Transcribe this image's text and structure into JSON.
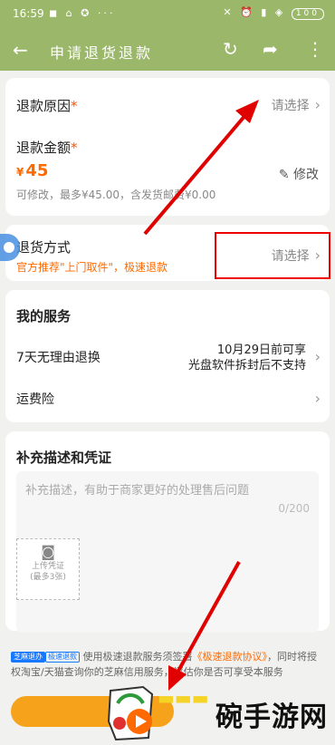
{
  "status_bar": {
    "time": "16:59",
    "left_icons": "◼ ⌂ ✪ ···",
    "right_icons": "✕ ⏰ ▮ ◈",
    "battery": "100"
  },
  "header": {
    "title": "申请退货退款"
  },
  "reason": {
    "label": "退款原因",
    "required_mark": "*",
    "action": "请选择",
    "chevron": "›"
  },
  "amount": {
    "label": "退款金额",
    "required_mark": "*",
    "currency": "¥",
    "value": "45",
    "hint": "可修改，最多¥45.00，含发货邮费¥0.00",
    "edit_label": "修改"
  },
  "return_method": {
    "label": "退货方式",
    "promo": "官方推荐\"上门取件\"，极速退款",
    "action": "请选择",
    "chevron": "›"
  },
  "services": {
    "title": "我的服务",
    "items": [
      {
        "label": "7天无理由退换",
        "detail_line1": "10月29日前可享",
        "detail_line2": "光盘软件拆封后不支持",
        "chevron": "›"
      },
      {
        "label": "运费险",
        "chevron": "›"
      }
    ]
  },
  "description": {
    "title": "补充描述和凭证",
    "placeholder": "补充描述，有助于商家更好的处理售后问题",
    "counter": "0/200",
    "upload_label": "上传凭证",
    "upload_sub": "(最多3张)"
  },
  "agreement": {
    "badge1": "芝麻退办",
    "badge2": "极速退款",
    "text_before": "使用极速退款服务须签署",
    "protocol": "《极速退款协议》",
    "text_after": "，同时将授权淘宝/天猫查询你的芝麻信用服务，评估你是否可享受本服务"
  },
  "watermark": {
    "text": "碗手游网"
  },
  "colors": {
    "header_bg": "#9bb86a",
    "accent_orange": "#ff6a00",
    "button_orange": "#f7a21b",
    "annotation_red": "#e00000"
  }
}
